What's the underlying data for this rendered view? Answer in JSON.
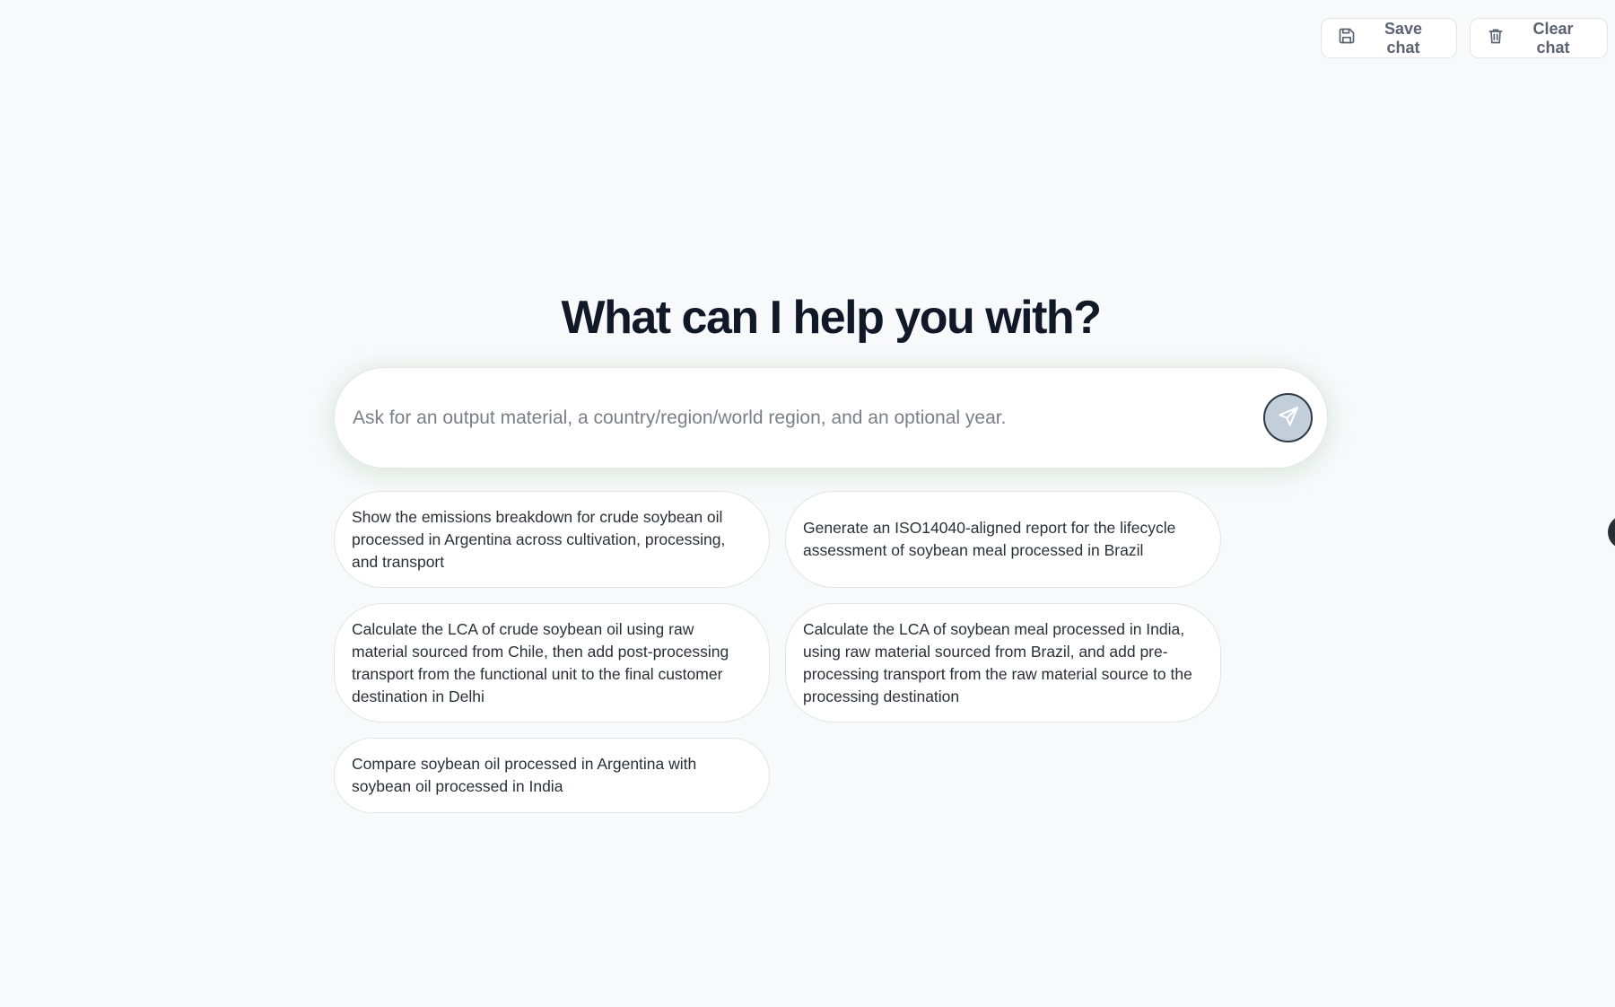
{
  "toolbar": {
    "save_label": "Save chat",
    "clear_label": "Clear chat"
  },
  "main": {
    "heading": "What can I help you with?",
    "search": {
      "placeholder": "Ask for an output material, a country/region/world region, and an optional year.",
      "value": ""
    },
    "suggestions": [
      "Show the emissions breakdown for crude soybean oil processed in Argentina across cultivation, processing, and transport",
      "Generate an ISO14040-aligned report for the lifecycle assessment of soybean meal processed in Brazil",
      "Calculate the LCA of crude soybean oil using raw material sourced from Chile, then add post-processing transport from the functional unit to the final customer destination in Delhi",
      "Calculate the LCA of soybean meal processed in India, using raw material sourced from Brazil, and add pre-processing transport from the raw material source to the processing destination",
      "Compare soybean oil processed in Argentina with soybean oil processed in India"
    ]
  },
  "icons": {
    "save": "floppy-disk-icon",
    "clear": "trash-icon",
    "send": "paper-plane-icon"
  },
  "colors": {
    "background": "#f8f9fb",
    "heading": "#111827",
    "glow": "#7ab46e",
    "send_button": "#c2cfdb"
  }
}
